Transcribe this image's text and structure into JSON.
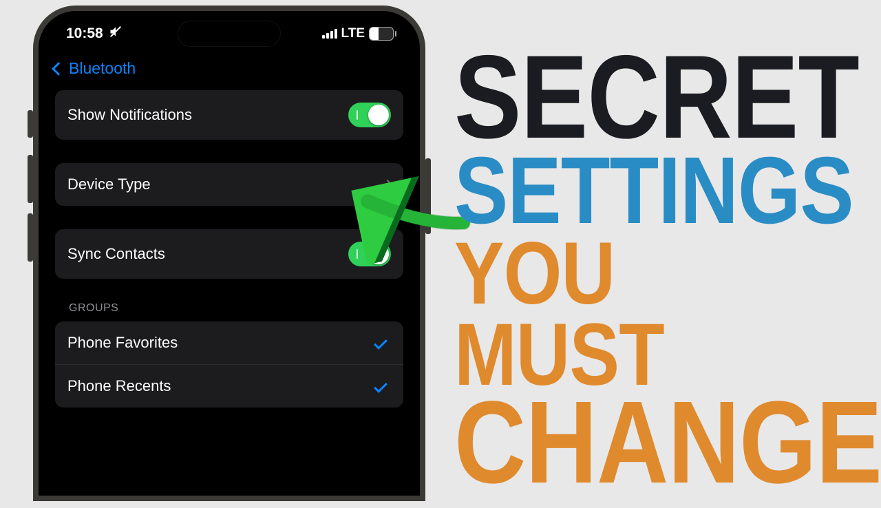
{
  "status": {
    "time": "10:58",
    "silent": true,
    "network": "LTE",
    "battery_pct": "39"
  },
  "nav": {
    "back_label": "Bluetooth"
  },
  "rows": {
    "show_notifications": {
      "label": "Show Notifications",
      "on": true
    },
    "device_type": {
      "label": "Device Type"
    },
    "sync_contacts": {
      "label": "Sync Contacts",
      "on": true
    }
  },
  "groups": {
    "section_label": "GROUPS",
    "items": [
      {
        "label": "Phone Favorites",
        "checked": true
      },
      {
        "label": "Phone Recents",
        "checked": true
      }
    ]
  },
  "headline": {
    "w1": "SECRET",
    "w2": "SETTINGS",
    "w3": "YOU MUST",
    "w4": "CHANGE"
  },
  "colors": {
    "accent_blue": "#0a84ff",
    "toggle_green": "#30d158",
    "headline_dark": "#1a1c21",
    "headline_blue": "#2a8cc4",
    "headline_orange": "#e08a2e",
    "arrow_green": "#2ecc40"
  }
}
